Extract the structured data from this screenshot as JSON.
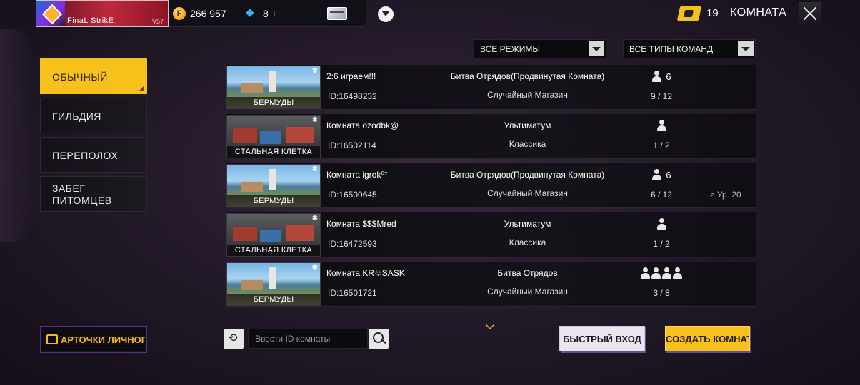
{
  "header": {
    "player_name": "FinaL StrikE",
    "player_tag": "V57",
    "gold": "266 957",
    "diamonds": "8 +",
    "tickets": "19",
    "page_title": "КОМНАТА"
  },
  "filters": {
    "modes": "ВСЕ РЕЖИМЫ",
    "team_types": "ВСЕ ТИПЫ КОМАНД"
  },
  "modes": [
    {
      "label": "ОБЫЧНЫЙ",
      "active": true
    },
    {
      "label": "ГИЛЬДИЯ",
      "active": false
    },
    {
      "label": "ПЕРЕПОЛОХ",
      "active": false
    },
    {
      "label": "ЗАБЕГ ПИТОМЦЕВ",
      "active": false
    }
  ],
  "rooms": [
    {
      "map": "БЕРМУДЫ",
      "name": "2:6 играем!!!",
      "id": "ID:16498232",
      "mode": "Битва Отрядов(Продвинутая Комната)",
      "sub": "Случайный Магазин",
      "team_size": "6",
      "players": "9 / 12",
      "level": ""
    },
    {
      "map": "СТАЛЬНАЯ КЛЕТКА",
      "name": "Комната ozodbk@",
      "id": "ID:16502114",
      "mode": "Ультиматум",
      "sub": "Классика",
      "team_size": "",
      "players": "1 / 2",
      "level": ""
    },
    {
      "map": "БЕРМУДЫ",
      "name": "Комната igrok⁰⁷",
      "id": "ID:16500645",
      "mode": "Битва Отрядов(Продвинутая Комната)",
      "sub": "Случайный Магазин",
      "team_size": "6",
      "players": "6 / 12",
      "level": "≥ Ур. 20"
    },
    {
      "map": "СТАЛЬНАЯ КЛЕТКА",
      "name": "Комната $$$Mred",
      "id": "ID:16472593",
      "mode": "Ультиматум",
      "sub": "Классика",
      "team_size": "",
      "players": "1 / 2",
      "level": ""
    },
    {
      "map": "БЕРМУДЫ",
      "name": "Комната KR♧SASK",
      "id": "ID:16501721",
      "mode": "Битва Отрядов",
      "sub": "Случайный Магазин",
      "team_size": "",
      "players": "3 / 8",
      "level": ""
    }
  ],
  "bottom": {
    "personal_cards": "АРТОЧКИ ЛИЧНОГО",
    "room_id_placeholder": "Ввести ID комнаты",
    "quick_join": "БЫСТРЫЙ ВХОД",
    "create_room": "СОЗДАТЬ КОМНАТУ"
  },
  "colors": {
    "accent": "#f6c11a",
    "background": "#241a2a",
    "purple_border": "#5a2f8a"
  }
}
